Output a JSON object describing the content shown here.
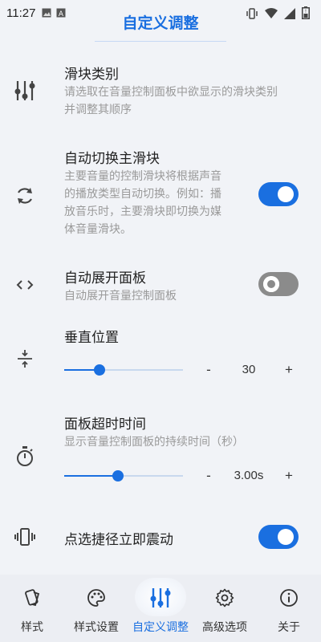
{
  "status_bar": {
    "time": "11:27"
  },
  "app_title": "自定义调整",
  "settings": {
    "slider_category": {
      "title": "滑块类别",
      "desc_line1": "请选取在音量控制面板中欲显示的滑块类别",
      "desc_line2": "并调整其顺序"
    },
    "auto_switch": {
      "title": "自动切换主滑块",
      "desc_line1": "主要音量的控制滑块将根据声音",
      "desc_line2": "的播放类型自动切换。例如：播",
      "desc_line3": "放音乐时，主要滑块即切换为媒",
      "desc_line4": "体音量滑块。",
      "enabled": true
    },
    "auto_expand": {
      "title": "自动展开面板",
      "desc": "自动展开音量控制面板",
      "enabled": false
    },
    "vertical_position": {
      "title": "垂直位置",
      "minus": "-",
      "value": "30",
      "plus": "+",
      "slider_fraction": 0.3
    },
    "panel_timeout": {
      "title": "面板超时时间",
      "desc": "显示音量控制面板的持续时间（秒）",
      "minus": "-",
      "value": "3.00s",
      "plus": "+",
      "slider_fraction": 0.45
    },
    "tap_vibrate": {
      "title": "点选捷径立即震动",
      "enabled": true
    }
  },
  "bottom_nav": {
    "items": [
      {
        "label": "样式",
        "icon": "cards-icon"
      },
      {
        "label": "样式设置",
        "icon": "palette-icon"
      },
      {
        "label": "自定义调整",
        "icon": "sliders-icon",
        "active": true
      },
      {
        "label": "高级选项",
        "icon": "gear-icon"
      },
      {
        "label": "关于",
        "icon": "info-icon"
      }
    ]
  },
  "colors": {
    "accent": "#1a6fe0",
    "background": "#f1f3f7",
    "toggle_off": "#8b8b8b"
  }
}
